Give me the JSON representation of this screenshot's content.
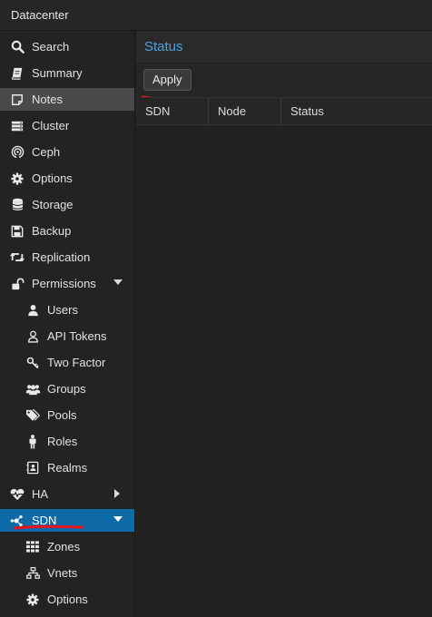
{
  "header": {
    "title": "Datacenter"
  },
  "sidebar": {
    "items": [
      {
        "label": "Search",
        "icon": "search-icon"
      },
      {
        "label": "Summary",
        "icon": "book-icon"
      },
      {
        "label": "Notes",
        "icon": "notes-icon"
      },
      {
        "label": "Cluster",
        "icon": "server-icon"
      },
      {
        "label": "Ceph",
        "icon": "ceph-icon"
      },
      {
        "label": "Options",
        "icon": "gear-icon"
      },
      {
        "label": "Storage",
        "icon": "database-icon"
      },
      {
        "label": "Backup",
        "icon": "floppy-icon"
      },
      {
        "label": "Replication",
        "icon": "retweet-icon"
      },
      {
        "label": "Permissions",
        "icon": "unlock-icon"
      },
      {
        "label": "Users",
        "icon": "user-icon"
      },
      {
        "label": "API Tokens",
        "icon": "user-outline-icon"
      },
      {
        "label": "Two Factor",
        "icon": "key-icon"
      },
      {
        "label": "Groups",
        "icon": "users-icon"
      },
      {
        "label": "Pools",
        "icon": "tags-icon"
      },
      {
        "label": "Roles",
        "icon": "male-icon"
      },
      {
        "label": "Realms",
        "icon": "address-book-icon"
      },
      {
        "label": "HA",
        "icon": "heartbeat-icon"
      },
      {
        "label": "SDN",
        "icon": "sdn-icon"
      },
      {
        "label": "Zones",
        "icon": "th-icon"
      },
      {
        "label": "Vnets",
        "icon": "sitemap-icon"
      },
      {
        "label": "Options",
        "icon": "gear-icon"
      }
    ]
  },
  "main": {
    "title": "Status",
    "toolbar": {
      "apply_label": "Apply"
    },
    "columns": [
      "SDN",
      "Node",
      "Status"
    ]
  },
  "colors": {
    "accent": "#0f6aa8",
    "title": "#4aa3df",
    "annotation": "#e8141b"
  }
}
